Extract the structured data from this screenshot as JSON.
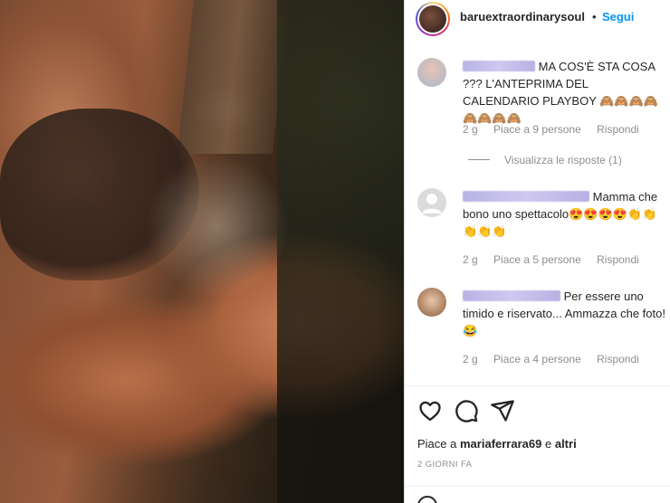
{
  "post": {
    "username": "baruextraordinarysoul",
    "separator": "•",
    "follow_label": "Segui"
  },
  "comments": [
    {
      "text": "MA COS'È STA COSA ??? L'ANTEPRIMA DEL CALENDARIO PLAYBOY 🙈🙈🙈🙈🙈🙈🙈🙈",
      "time": "2 g",
      "likes": "Piace a 9 persone",
      "reply": "Rispondi"
    },
    {
      "text": "Mamma che bono uno spettacolo😍😍😍😍👏👏👏👏👏",
      "time": "2 g",
      "likes": "Piace a 5 persone",
      "reply": "Rispondi"
    },
    {
      "text": "Per essere uno timido e riservato... Ammazza che foto! 😂",
      "time": "2 g",
      "likes": "Piace a 4 persone",
      "reply": "Rispondi"
    }
  ],
  "view_replies": "Visualizza le risposte (1)",
  "actions": {
    "like_icon": "heart-icon",
    "comment_icon": "comment-icon",
    "share_icon": "send-icon"
  },
  "likes": {
    "prefix": "Piace a",
    "user": "mariaferrara69",
    "conj": "e",
    "others": "altri"
  },
  "timestamp": "2 GIORNI FA",
  "colors": {
    "accent": "#0095f6",
    "text": "#262626",
    "muted": "#8e8e8e"
  }
}
